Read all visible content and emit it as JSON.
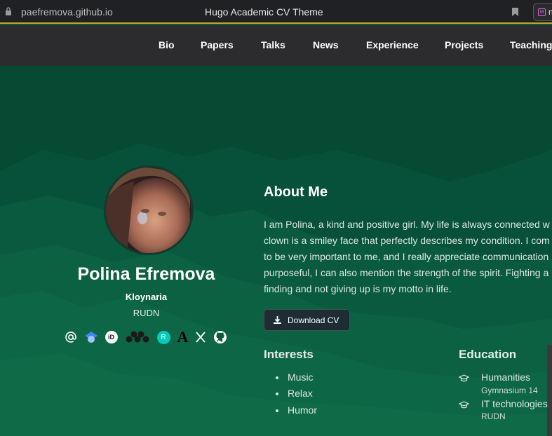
{
  "browser": {
    "url": "paefremova.github.io",
    "tab_title": "Hugo Academic CV Theme",
    "ext_letter": "n",
    "ext_logo_text": "M"
  },
  "nav": {
    "items": [
      "Bio",
      "Papers",
      "Talks",
      "News",
      "Experience",
      "Projects",
      "Teaching"
    ]
  },
  "profile": {
    "name": "Polina Efremova",
    "role": "Kloynaria",
    "organization": "RUDN",
    "social_icons": [
      "email-icon",
      "google-scholar-icon",
      "orcid-icon",
      "mendeley-icon",
      "researchgate-icon",
      "academia-icon",
      "x-icon",
      "github-icon"
    ],
    "orcid_text": "iD",
    "researchgate_text": "R",
    "academia_text": "A"
  },
  "about": {
    "title": "About Me",
    "bio_lines": [
      "I am Polina, a kind and positive girl. My life is always connected w",
      "clown is a smiley face that perfectly describes my condition. I com",
      "to be very important to me, and I really appreciate communication",
      "purposeful, I can also mention the strength of the spirit. Fighting a",
      "finding and not giving up is my motto in life."
    ],
    "cv_button": "Download CV"
  },
  "interests": {
    "title": "Interests",
    "items": [
      "Music",
      "Relax",
      "Humor"
    ]
  },
  "education": {
    "title": "Education",
    "items": [
      {
        "course": "Humanities",
        "institution": "Gymnasium 14"
      },
      {
        "course": "IT technologies",
        "institution": "RUDN"
      }
    ]
  },
  "colors": {
    "accent": "#c9a227",
    "navbar": "#2c2c2e",
    "hero_top": "#064a33",
    "hero_band": "#0d6445",
    "button_bg": "#1e2d33"
  }
}
